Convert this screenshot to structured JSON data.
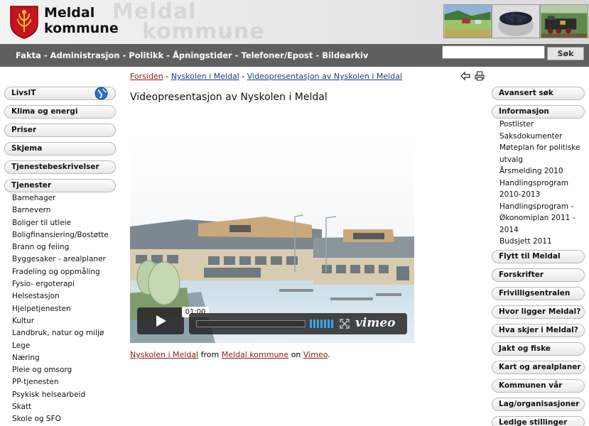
{
  "header": {
    "site_name_line1": "Meldal",
    "site_name_line2": "kommune",
    "ghost_line1": "Meldal",
    "ghost_line2": "kommune"
  },
  "nav": {
    "items": [
      "Fakta",
      "Administrasjon",
      "Politikk",
      "Åpningstider",
      "Telefoner/Epost",
      "Bildearkiv"
    ],
    "separator": "-"
  },
  "search": {
    "value": "",
    "button_label": "Søk"
  },
  "left_sidebar": {
    "buttons": [
      "LivsIT",
      "Klima og energi",
      "Priser",
      "Skjema",
      "Tjenestebeskrivelser",
      "Tjenester"
    ],
    "tjenester_items": [
      "Barnehager",
      "Barnevern",
      "Boliger til utleie",
      "Boligfinansiering/Bostøtte",
      "Brann og feiing",
      "Byggesaker - arealplaner",
      "Fradeling og oppmåling",
      "Fysio- ergoterapi",
      "Helsestasjon",
      "Hjelpetjenesten",
      "Kultur",
      "Landbruk, natur og miljø",
      "Lege",
      "Næring",
      "Pleie og omsorg",
      "PP-tjenesten",
      "Psykisk helsearbeid",
      "Skatt",
      "Skole og SFO"
    ]
  },
  "breadcrumb": {
    "home": "Forsiden",
    "parent": "Nyskolen i Meldal",
    "current": "Videopresentasjon av Nyskolen i Meldal",
    "separator": "-"
  },
  "page_title": "Videopresentasjon av Nyskolen i Meldal",
  "video": {
    "timestamp": "01:00",
    "brand": "vimeo",
    "progress": 0.0
  },
  "caption": {
    "video_link": "Nyskolen i Meldal",
    "from": "from",
    "author_link": "Meldal kommune",
    "on": "on",
    "platform_link": "Vimeo",
    "end": "."
  },
  "right_sidebar": {
    "top_buttons": [
      "Avansert søk",
      "Informasjon"
    ],
    "informasjon_items": [
      "Postlister",
      "Saksdokumenter",
      "Møteplan for politiske utvalg",
      "Årsmelding 2010",
      "Handlingsprogram 2010-2013",
      "Handlingsprogram - Økonomiplan 2011 - 2014",
      "Budsjett 2011"
    ],
    "buttons": [
      "Flytt til Meldal",
      "Forskrifter",
      "Frivilligsentralen",
      "Hvor ligger Meldal?",
      "Hva skjer i Meldal?",
      "Jakt og fiske",
      "Kart og arealplaner",
      "Kommunen vår",
      "Lag/organisasjoner",
      "Ledige stillinger"
    ]
  },
  "colors": {
    "navbar": "#5f5f5f",
    "crest_red": "#c8141e",
    "crest_gold": "#f2c12e",
    "link_red": "#8a1a1a",
    "link_blue": "#1a3c8a"
  }
}
